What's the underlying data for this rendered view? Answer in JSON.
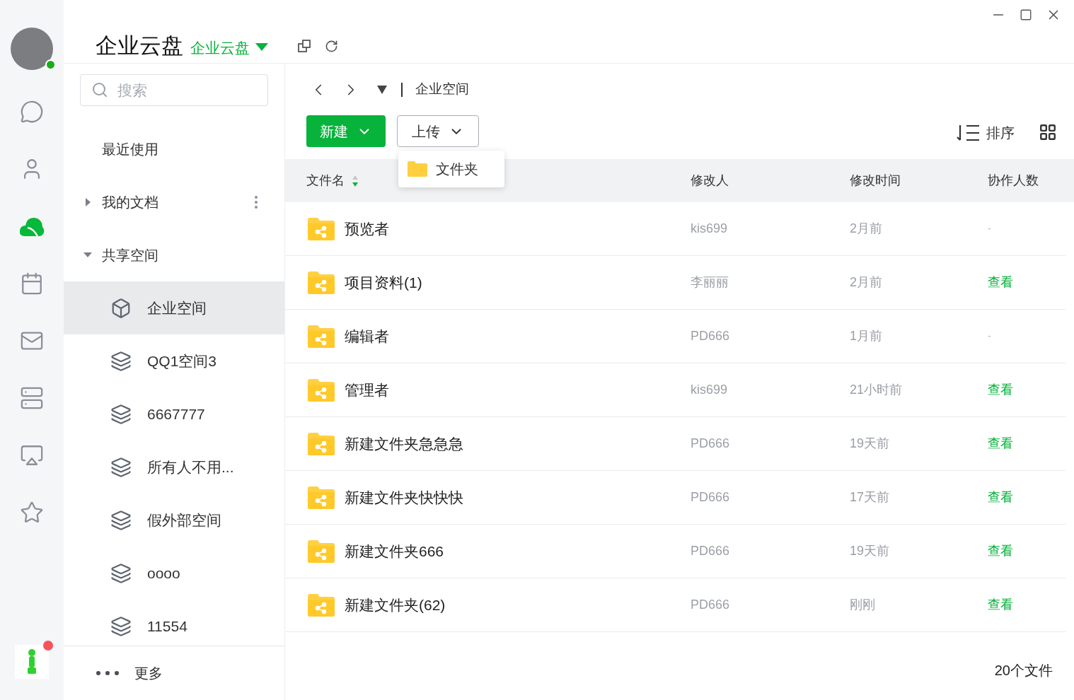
{
  "user": {
    "online": true
  },
  "rail": [
    {
      "kind": "chat",
      "selected": false
    },
    {
      "kind": "contacts",
      "selected": false
    },
    {
      "kind": "cloud",
      "selected": true
    },
    {
      "kind": "calendar",
      "selected": false
    },
    {
      "kind": "mail",
      "selected": false
    },
    {
      "kind": "server",
      "selected": false
    },
    {
      "kind": "screen",
      "selected": false
    },
    {
      "kind": "star",
      "selected": false
    }
  ],
  "app_badge": true,
  "header": {
    "title": "企业云盘",
    "switcher": "企业云盘"
  },
  "search": {
    "placeholder": "搜索"
  },
  "sidebar": {
    "items": [
      {
        "kind": "link",
        "label": "最近使用"
      },
      {
        "kind": "tree_menu",
        "label": "我的文档",
        "expanded": false
      },
      {
        "kind": "tree",
        "label": "共享空间",
        "expanded": true
      }
    ],
    "spaces": [
      {
        "kind": "enterprise",
        "label": "企业空间",
        "selected": true
      },
      {
        "kind": "team",
        "label": "QQ1空间3",
        "selected": false
      },
      {
        "kind": "team",
        "label": "6667777",
        "selected": false
      },
      {
        "kind": "team",
        "label": "所有人不用...",
        "selected": false
      },
      {
        "kind": "team",
        "label": "假外部空间",
        "selected": false
      },
      {
        "kind": "team",
        "label": "oooo",
        "selected": false
      },
      {
        "kind": "team",
        "label": "11554",
        "selected": false
      }
    ],
    "more": "更多"
  },
  "breadcrumb": "企业空间",
  "toolbar": {
    "new": "新建",
    "upload": "上传",
    "upload_menu": [
      "文件夹"
    ],
    "sort": "排序"
  },
  "table": {
    "columns": [
      {
        "label": "文件名",
        "sorted": true
      },
      {
        "label": "修改人",
        "sorted": false
      },
      {
        "label": "修改时间",
        "sorted": false
      },
      {
        "label": "协作人数",
        "sorted": false
      }
    ],
    "rows": [
      {
        "kind": "dash",
        "name": "预览者",
        "modifier": "kis699",
        "time": "2月前",
        "collab": "-"
      },
      {
        "kind": "link",
        "name": "项目资料(1)",
        "modifier": "李丽丽",
        "time": "2月前",
        "collab": "查看"
      },
      {
        "kind": "dash",
        "name": "编辑者",
        "modifier": "PD666",
        "time": "1月前",
        "collab": "-"
      },
      {
        "kind": "link",
        "name": "管理者",
        "modifier": "kis699",
        "time": "21小时前",
        "collab": "查看"
      },
      {
        "kind": "link",
        "name": "新建文件夹急急急",
        "modifier": "PD666",
        "time": "19天前",
        "collab": "查看"
      },
      {
        "kind": "link",
        "name": "新建文件夹快快快",
        "modifier": "PD666",
        "time": "17天前",
        "collab": "查看"
      },
      {
        "kind": "link",
        "name": "新建文件夹666",
        "modifier": "PD666",
        "time": "19天前",
        "collab": "查看"
      },
      {
        "kind": "link",
        "name": "新建文件夹(62)",
        "modifier": "PD666",
        "time": "刚刚",
        "collab": "查看"
      }
    ]
  },
  "file_count": "20个文件"
}
